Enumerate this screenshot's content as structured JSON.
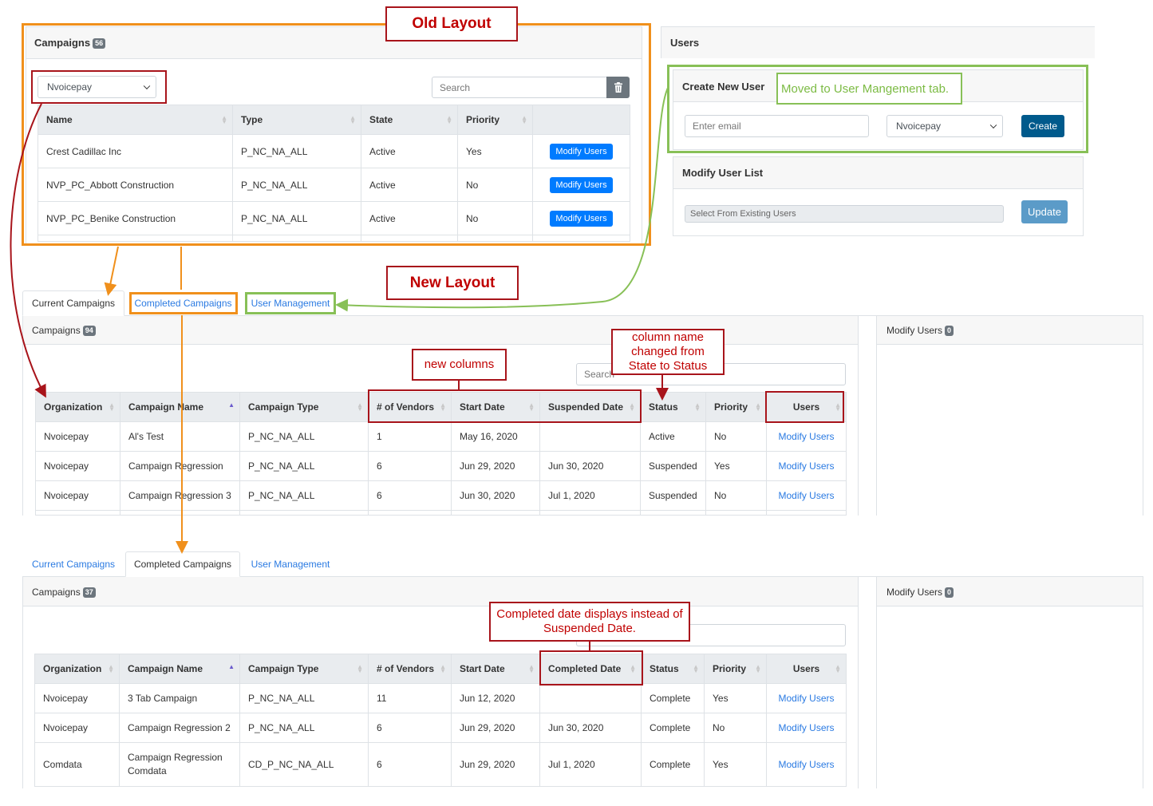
{
  "annotations": {
    "old_layout": "Old Layout",
    "new_layout": "New Layout",
    "moved_note": "Moved to User Mangement tab.",
    "new_columns": "new columns",
    "column_renamed": "column name changed from State to Status",
    "completed_note": "Completed date displays instead of Suspended Date."
  },
  "colors": {
    "annotation_red": "#a8141b",
    "annotation_orange": "#f0901c",
    "annotation_green": "#88c057",
    "link_blue": "#2a7ae2",
    "primary_button": "#007bff",
    "create_button": "#005a8c",
    "update_button": "#5b9bc8"
  },
  "old": {
    "campaigns_title": "Campaigns",
    "campaigns_count": "56",
    "org_select": "Nvoicepay",
    "search_placeholder": "Search",
    "delete_icon": "trash-icon",
    "columns": [
      "Name",
      "Type",
      "State",
      "Priority",
      ""
    ],
    "rows": [
      {
        "name": "Crest Cadillac Inc",
        "type": "P_NC_NA_ALL",
        "state": "Active",
        "priority": "Yes",
        "action": "Modify Users"
      },
      {
        "name": "NVP_PC_Abbott Construction",
        "type": "P_NC_NA_ALL",
        "state": "Active",
        "priority": "No",
        "action": "Modify Users"
      },
      {
        "name": "NVP_PC_Benike Construction",
        "type": "P_NC_NA_ALL",
        "state": "Active",
        "priority": "No",
        "action": "Modify Users"
      }
    ],
    "users": {
      "title": "Users",
      "create_title": "Create New User",
      "email_placeholder": "Enter email",
      "org_select": "Nvoicepay",
      "create_button": "Create",
      "modify_title": "Modify User List",
      "select_placeholder": "Select From Existing Users",
      "update_button": "Update"
    }
  },
  "new1": {
    "tabs": [
      "Current Campaigns",
      "Completed Campaigns",
      "User Management"
    ],
    "active_tab": "Current Campaigns",
    "campaigns_title": "Campaigns",
    "campaigns_count": "94",
    "search_placeholder": "Search",
    "modify_users_title": "Modify Users",
    "modify_users_count": "0",
    "columns": [
      "Organization",
      "Campaign Name",
      "Campaign Type",
      "# of Vendors",
      "Start Date",
      "Suspended Date",
      "Status",
      "Priority",
      "Users"
    ],
    "rows": [
      {
        "org": "Nvoicepay",
        "name": "Al's Test",
        "type": "P_NC_NA_ALL",
        "vendors": "1",
        "start": "May 16, 2020",
        "date2": "",
        "status": "Active",
        "priority": "No",
        "users": "Modify Users"
      },
      {
        "org": "Nvoicepay",
        "name": "Campaign Regression",
        "type": "P_NC_NA_ALL",
        "vendors": "6",
        "start": "Jun 29, 2020",
        "date2": "Jun 30, 2020",
        "status": "Suspended",
        "priority": "Yes",
        "users": "Modify Users"
      },
      {
        "org": "Nvoicepay",
        "name": "Campaign Regression 3",
        "type": "P_NC_NA_ALL",
        "vendors": "6",
        "start": "Jun 30, 2020",
        "date2": "Jul 1, 2020",
        "status": "Suspended",
        "priority": "No",
        "users": "Modify Users"
      }
    ]
  },
  "new2": {
    "tabs": [
      "Current Campaigns",
      "Completed Campaigns",
      "User Management"
    ],
    "active_tab": "Completed Campaigns",
    "campaigns_title": "Campaigns",
    "campaigns_count": "37",
    "modify_users_title": "Modify Users",
    "modify_users_count": "0",
    "columns": [
      "Organization",
      "Campaign Name",
      "Campaign Type",
      "# of Vendors",
      "Start Date",
      "Completed Date",
      "Status",
      "Priority",
      "Users"
    ],
    "rows": [
      {
        "org": "Nvoicepay",
        "name": "3 Tab Campaign",
        "type": "P_NC_NA_ALL",
        "vendors": "11",
        "start": "Jun 12, 2020",
        "date2": "",
        "status": "Complete",
        "priority": "Yes",
        "users": "Modify Users"
      },
      {
        "org": "Nvoicepay",
        "name": "Campaign Regression 2",
        "type": "P_NC_NA_ALL",
        "vendors": "6",
        "start": "Jun 29, 2020",
        "date2": "Jun 30, 2020",
        "status": "Complete",
        "priority": "No",
        "users": "Modify Users"
      },
      {
        "org": "Comdata",
        "name": "Campaign Regression Comdata",
        "type": "CD_P_NC_NA_ALL",
        "vendors": "6",
        "start": "Jun 29, 2020",
        "date2": "Jul 1, 2020",
        "status": "Complete",
        "priority": "Yes",
        "users": "Modify Users"
      }
    ]
  }
}
